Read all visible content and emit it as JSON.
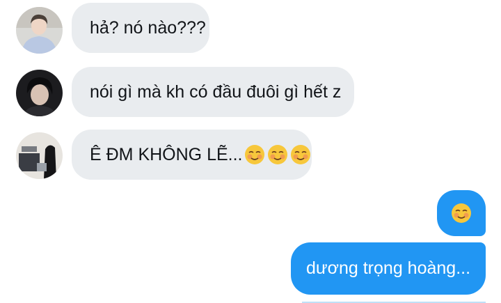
{
  "messages": {
    "incoming": [
      {
        "avatar": "avatar-white-hoodie",
        "text": "hả? nó nào???"
      },
      {
        "avatar": "avatar-dark-hair",
        "text": "nói gì mà kh có đầu đuôi gì hết z"
      },
      {
        "avatar": "avatar-room-photo",
        "text": "Ê ĐM KHÔNG LẼ...",
        "emojis": [
          "smiling-face-icon",
          "smiling-face-icon",
          "smiling-face-icon"
        ]
      }
    ],
    "outgoing": [
      {
        "emoji": "smiling-face-icon"
      },
      {
        "text": "dương trọng hoàng..."
      }
    ]
  },
  "colors": {
    "incoming_bubble": "#e9ecef",
    "outgoing_bubble": "#2196f3",
    "incoming_text": "#111418",
    "outgoing_text": "#ffffff"
  }
}
